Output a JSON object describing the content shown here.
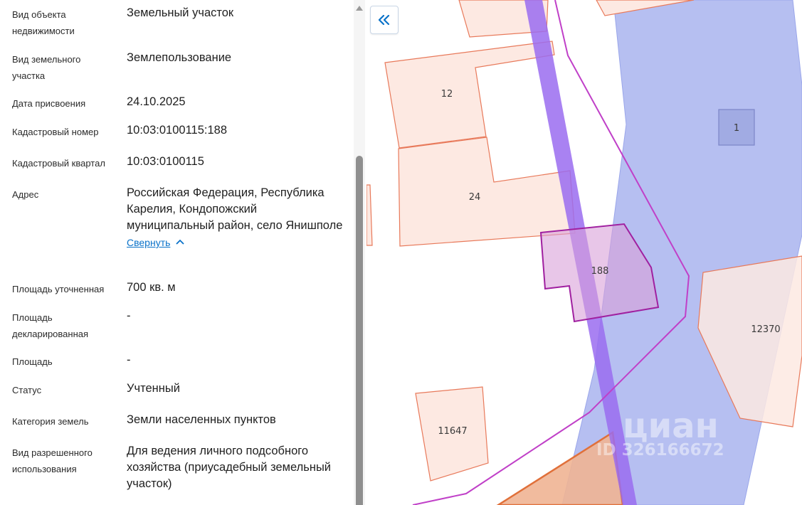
{
  "properties": [
    {
      "label": "Вид объекта недвижимости",
      "value": "Земельный участок"
    },
    {
      "label": "Вид земельного участка",
      "value": "Землепользование"
    },
    {
      "label": "Дата присвоения",
      "value": "24.10.2025"
    },
    {
      "label": "Кадастровый номер",
      "value": "10:03:0100115:188"
    },
    {
      "label": "Кадастровый квартал",
      "value": "10:03:0100115"
    },
    {
      "label": "Адрес",
      "value": "Российская Федерация, Республика Карелия, Кондопожский муниципальный район, село Янишполе"
    },
    {
      "label": "Площадь уточненная",
      "value": "700 кв. м"
    },
    {
      "label": "Площадь декларированная",
      "value": "-"
    },
    {
      "label": "Площадь",
      "value": "-"
    },
    {
      "label": "Статус",
      "value": "Учтенный"
    },
    {
      "label": "Категория земель",
      "value": "Земли населенных пунктов"
    },
    {
      "label": "Вид разрешенного использования",
      "value": "Для ведения личного подсобного хозяйства (приусадебный земельный участок)"
    }
  ],
  "address_toggle_label": "Свернуть",
  "map": {
    "collapse_button_icon": "double-chevron-left-icon",
    "parcel_labels": {
      "p12": "12",
      "p24": "24",
      "p188": "188",
      "p1": "1",
      "p12370": "12370",
      "p11647": "11647"
    },
    "watermark": {
      "brand": "циан",
      "id_text": "ID 326166672"
    },
    "colors": {
      "selected_parcel": "#a020a0",
      "neighbor_parcel": "#e8795a",
      "water_zone": "#a9b4ee",
      "road_band": "#9a6cf0",
      "accent": "#0a72c9"
    }
  }
}
